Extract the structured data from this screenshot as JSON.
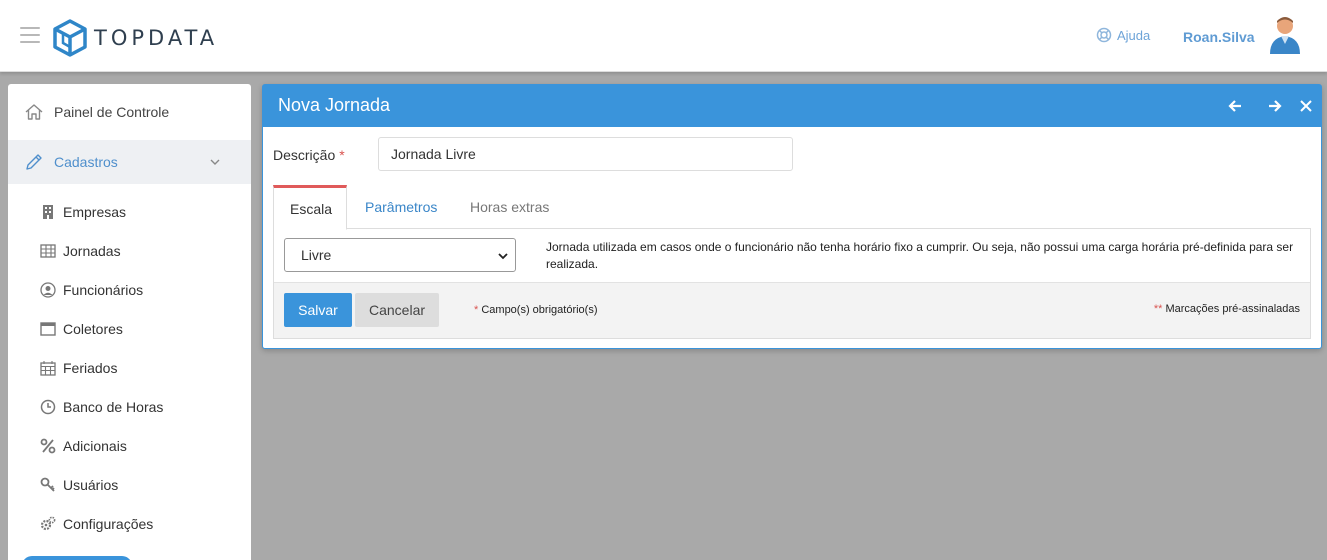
{
  "header": {
    "brand": "TOPDATA",
    "help_label": "Ajuda",
    "user_name": "Roan.Silva"
  },
  "sidebar": {
    "items": [
      {
        "label": "Painel de Controle",
        "icon": "home-icon"
      },
      {
        "label": "Cadastros",
        "icon": "pencil-icon",
        "active": true
      },
      {
        "label": "Empresas",
        "icon": "building-icon"
      },
      {
        "label": "Jornadas",
        "icon": "table-icon"
      },
      {
        "label": "Funcionários",
        "icon": "user-circle-icon"
      },
      {
        "label": "Coletores",
        "icon": "window-icon"
      },
      {
        "label": "Feriados",
        "icon": "calendar-icon"
      },
      {
        "label": "Banco de Horas",
        "icon": "clock-icon"
      },
      {
        "label": "Adicionais",
        "icon": "percent-icon"
      },
      {
        "label": "Usuários",
        "icon": "key-icon"
      },
      {
        "label": "Configurações",
        "icon": "gears-icon"
      }
    ]
  },
  "modal": {
    "title": "Nova Jornada",
    "description_label": "Descrição",
    "required_mark": "*",
    "description_value": "Jornada Livre",
    "tabs": [
      "Escala",
      "Parâmetros",
      "Horas extras"
    ],
    "escala_selected": "Livre",
    "escala_description": "Jornada utilizada em casos onde o funcionário não tenha horário fixo a cumprir. Ou seja, não possui uma carga horária pré-definida para ser realizada.",
    "save_label": "Salvar",
    "cancel_label": "Cancelar",
    "required_note": "Campo(s) obrigatório(s)",
    "required_note_mark": "*",
    "premarked_note": "Marcações pré-assinaladas",
    "premarked_note_mark": "**"
  },
  "colors": {
    "accent": "#3a94db",
    "tab_active_border": "#e05a5a",
    "background": "#a9a9a9"
  }
}
